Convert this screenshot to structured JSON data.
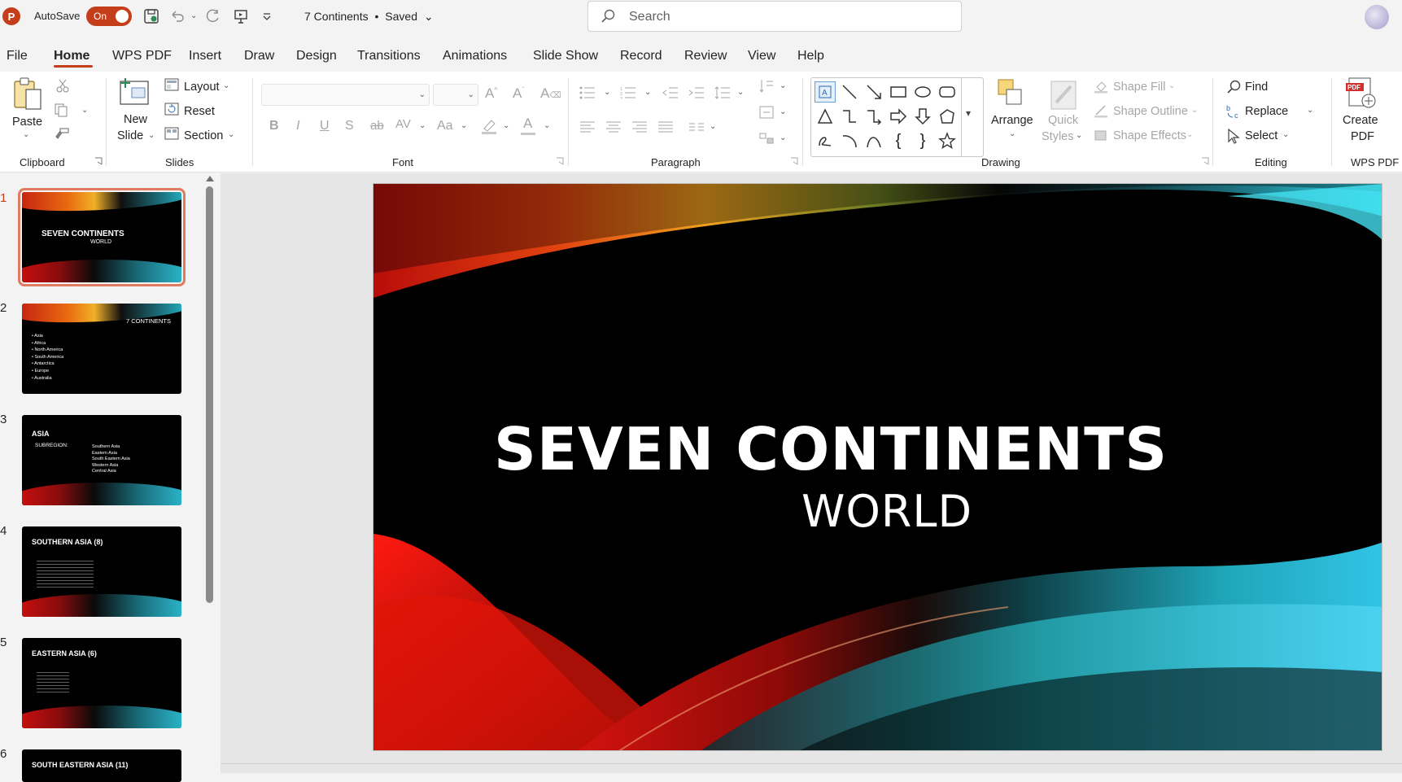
{
  "titlebar": {
    "app_letter": "P",
    "autosave_label": "AutoSave",
    "autosave_state": "On",
    "doc_title": "7 Continents",
    "save_status": "Saved",
    "search_placeholder": "Search"
  },
  "tabs": [
    "File",
    "Home",
    "WPS PDF",
    "Insert",
    "Draw",
    "Design",
    "Transitions",
    "Animations",
    "Slide Show",
    "Record",
    "Review",
    "View",
    "Help"
  ],
  "active_tab": "Home",
  "ribbon": {
    "clipboard": {
      "paste": "Paste",
      "label": "Clipboard"
    },
    "slides": {
      "new_slide_line1": "New",
      "new_slide_line2": "Slide",
      "layout": "Layout",
      "reset": "Reset",
      "section": "Section",
      "label": "Slides"
    },
    "font": {
      "label": "Font"
    },
    "paragraph": {
      "label": "Paragraph"
    },
    "drawing": {
      "arrange": "Arrange",
      "quick_styles_line1": "Quick",
      "quick_styles_line2": "Styles",
      "shape_fill": "Shape Fill",
      "shape_outline": "Shape Outline",
      "shape_effects": "Shape Effects",
      "label": "Drawing"
    },
    "editing": {
      "find": "Find",
      "replace": "Replace",
      "select": "Select",
      "label": "Editing"
    },
    "wps_pdf": {
      "create_line1": "Create",
      "create_line2": "PDF",
      "label": "WPS PDF"
    }
  },
  "slides": [
    {
      "num": "1",
      "title": "SEVEN CONTINENTS",
      "subtitle": "WORLD"
    },
    {
      "num": "2",
      "title": "7 CONTINENTS",
      "bullets": [
        "• Asia",
        "• Africa",
        "• North America",
        "• South America",
        "• Antarctica",
        "• Europe",
        "• Australia"
      ]
    },
    {
      "num": "3",
      "title": "ASIA",
      "sub_label": "SUBREGION:",
      "items": [
        "Southern Asia",
        "Eastern Asia",
        "South Eastern Asia",
        "Western Asia",
        "Central Asia"
      ]
    },
    {
      "num": "4",
      "title": "SOUTHERN ASIA (8)"
    },
    {
      "num": "5",
      "title": "EASTERN ASIA (6)"
    },
    {
      "num": "6",
      "title": "SOUTH EASTERN ASIA (11)"
    }
  ],
  "main_slide": {
    "title": "SEVEN CONTINENTS",
    "subtitle": "WORLD"
  },
  "colors": {
    "accent": "#c43e1c",
    "ribbon_bg": "#ffffff",
    "window_bg": "#f3f3f3"
  }
}
